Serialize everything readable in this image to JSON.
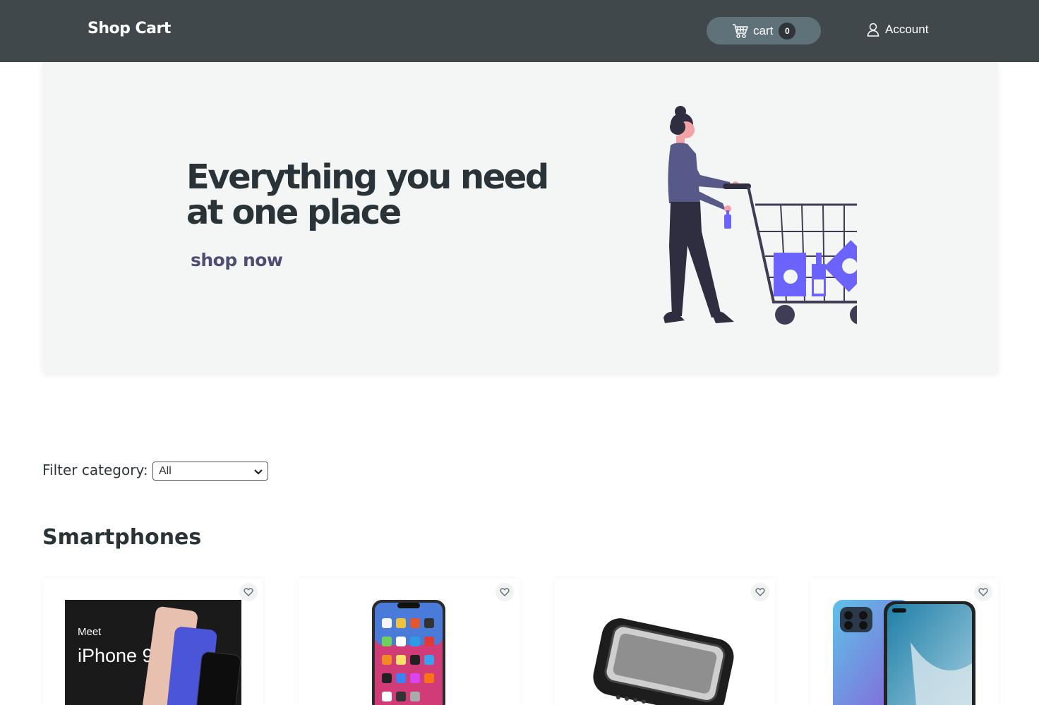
{
  "navbar": {
    "brand": "Shop Cart",
    "cart_label": "cart",
    "cart_count": "0",
    "account_label": "Account"
  },
  "hero": {
    "title": "Everything you need at one place",
    "cta": "shop now"
  },
  "filter": {
    "label": "Filter category:",
    "selected": "All"
  },
  "section": {
    "title": "Smartphones"
  },
  "products": [
    {
      "image_text_small": "Meet",
      "image_text_large": "iPhone 9"
    },
    {},
    {},
    {}
  ],
  "colors": {
    "navbar_bg": "#41484c",
    "cart_pill": "#5f7179",
    "accent_purple": "#6c63ff",
    "hero_bg": "#f4f6f5",
    "cta_text": "#4e4e74"
  }
}
